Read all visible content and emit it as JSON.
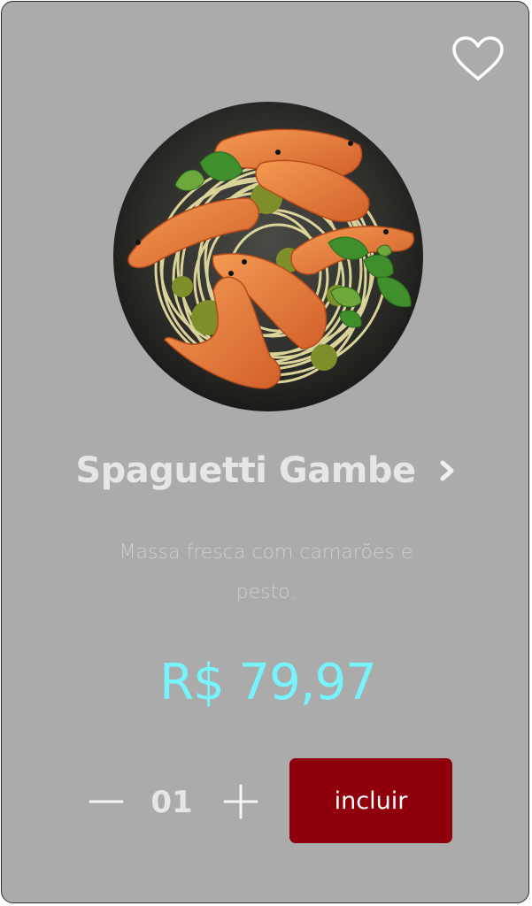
{
  "product": {
    "name": "Spaguetti Gambe",
    "description": "Massa fresca com camarões e pesto.",
    "price": "R$ 79,97",
    "quantity": "01",
    "add_button_label": "incluir",
    "favorite": false
  },
  "icons": {
    "favorite": "heart-outline-icon",
    "details": "chevron-right-icon",
    "decrease": "minus-icon",
    "increase": "plus-icon"
  },
  "colors": {
    "card_background": "#ababab",
    "price": "#76f3fb",
    "add_button": "#8e000c",
    "title": "#e6e6e6"
  }
}
